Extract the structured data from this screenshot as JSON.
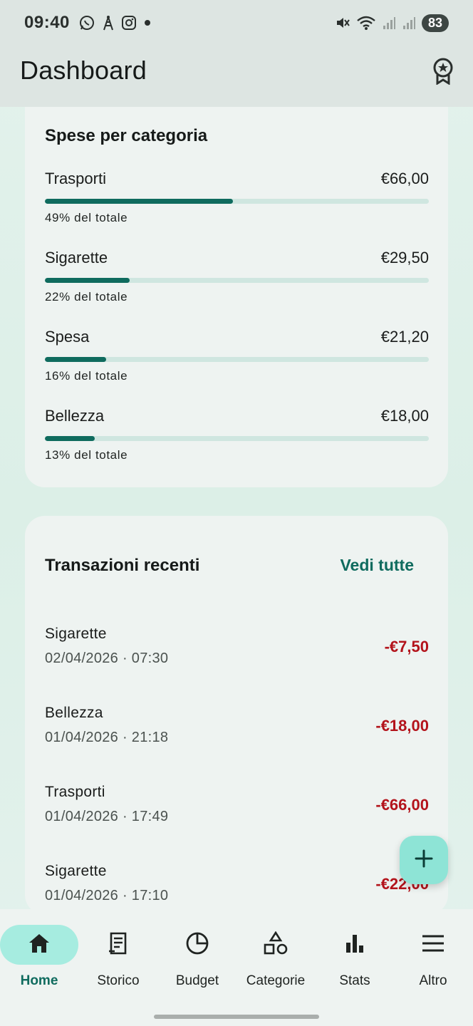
{
  "status_bar": {
    "time": "09:40",
    "battery": "83",
    "left_icons": [
      "whatsapp-icon",
      "antenna-icon",
      "instagram-icon",
      "dot-icon"
    ],
    "right_icons": [
      "mute-icon",
      "wifi-icon",
      "signal-icon",
      "signal-icon"
    ]
  },
  "app_bar": {
    "title": "Dashboard",
    "action_icon": "award-icon"
  },
  "category_card": {
    "title": "Spese per categoria",
    "items": [
      {
        "name": "Trasporti",
        "amount": "€66,00",
        "percent_label": "49% del totale",
        "percent": 49
      },
      {
        "name": "Sigarette",
        "amount": "€29,50",
        "percent_label": "22% del totale",
        "percent": 22
      },
      {
        "name": "Spesa",
        "amount": "€21,20",
        "percent_label": "16% del totale",
        "percent": 16
      },
      {
        "name": "Bellezza",
        "amount": "€18,00",
        "percent_label": "13% del totale",
        "percent": 13
      }
    ],
    "colors": {
      "fill": "#0f6b5e",
      "track": "#cfe6e0"
    }
  },
  "transactions_card": {
    "title": "Transazioni recenti",
    "see_all": "Vedi tutte",
    "items": [
      {
        "name": "Sigarette",
        "date": "02/04/2026 · 07:30",
        "amount": "-€7,50"
      },
      {
        "name": "Bellezza",
        "date": "01/04/2026 · 21:18",
        "amount": "-€18,00"
      },
      {
        "name": "Trasporti",
        "date": "01/04/2026 · 17:49",
        "amount": "-€66,00"
      },
      {
        "name": "Sigarette",
        "date": "01/04/2026 · 17:10",
        "amount": "-€22,00"
      }
    ],
    "colors": {
      "expense": "#b3131b"
    }
  },
  "fab": {
    "icon": "plus-icon"
  },
  "bottom_nav": {
    "active": "Home",
    "items": [
      {
        "label": "Home",
        "icon": "home-icon"
      },
      {
        "label": "Storico",
        "icon": "receipt-icon"
      },
      {
        "label": "Budget",
        "icon": "pie-icon"
      },
      {
        "label": "Categorie",
        "icon": "shapes-icon"
      },
      {
        "label": "Stats",
        "icon": "bar-chart-icon"
      },
      {
        "label": "Altro",
        "icon": "menu-icon"
      }
    ]
  },
  "colors": {
    "accent": "#0f6b5e",
    "nav_active_pill": "#a6ece0",
    "fab": "#8ee4d6"
  }
}
